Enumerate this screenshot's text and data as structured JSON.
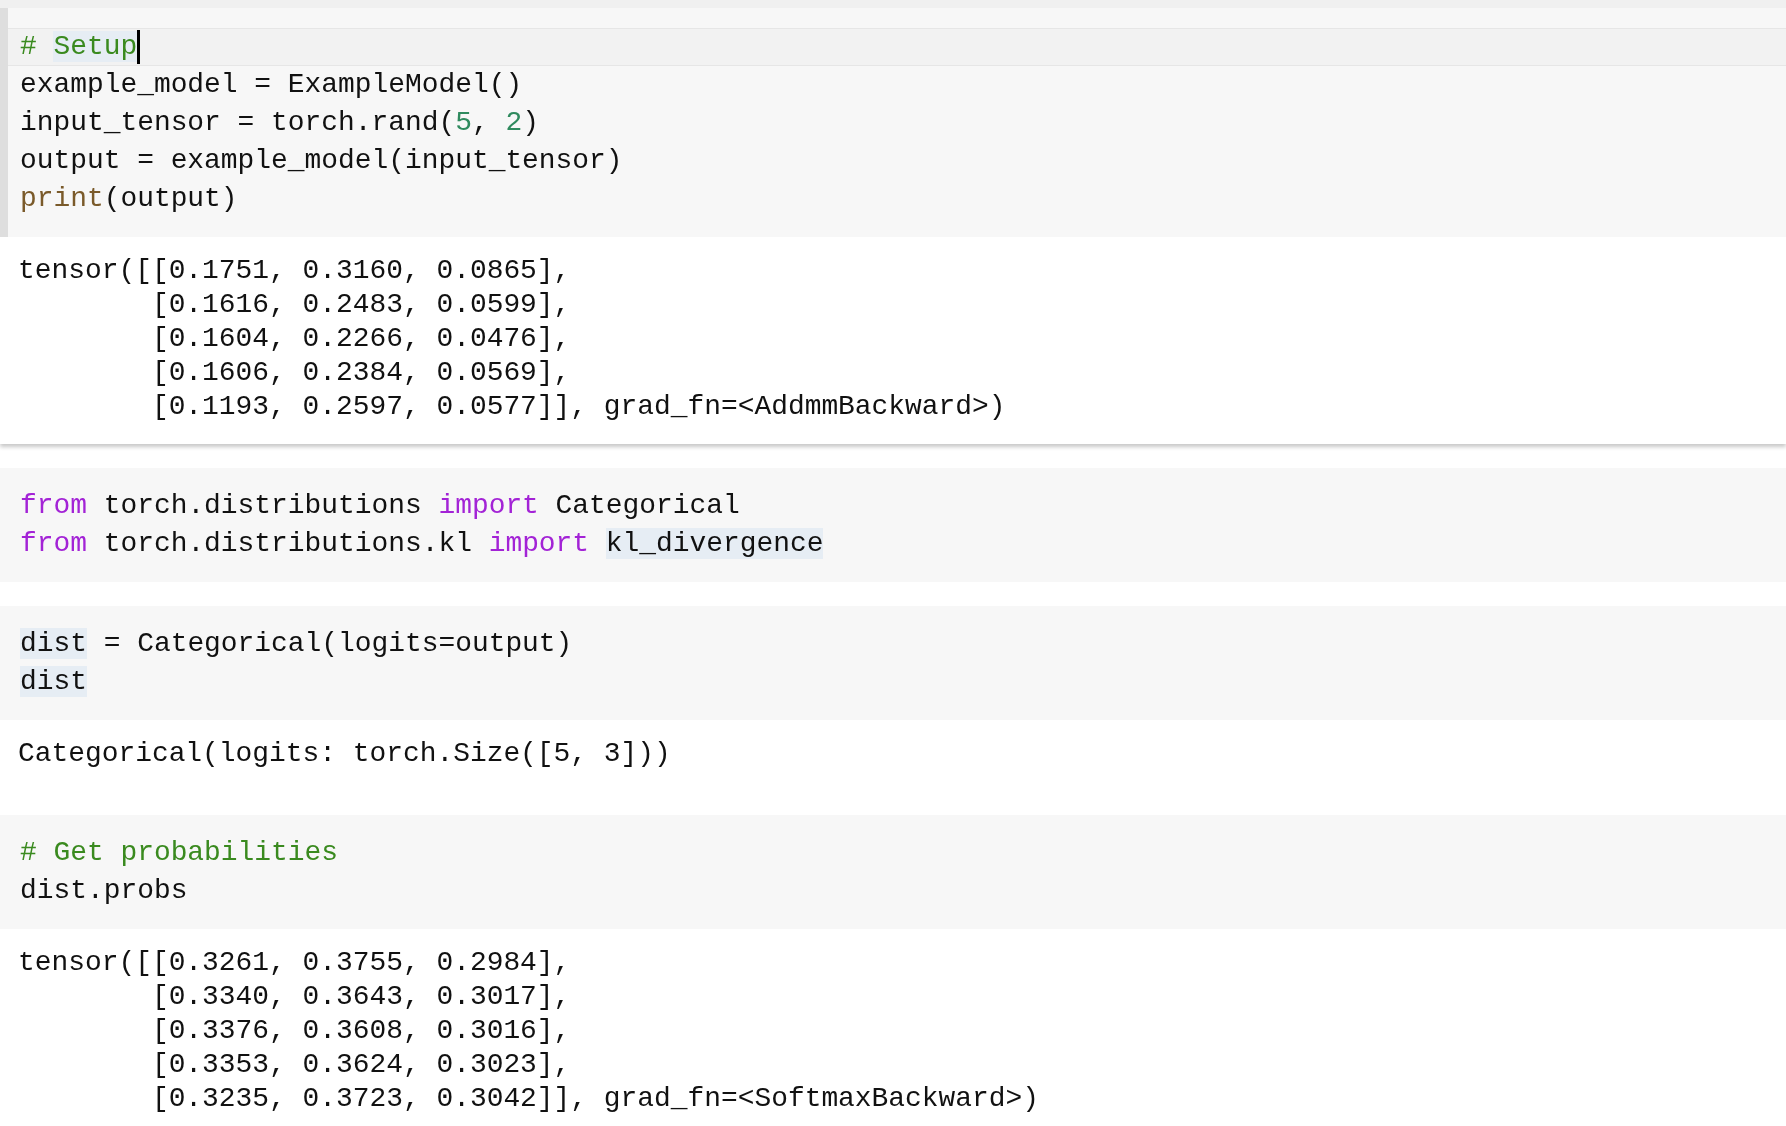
{
  "cells": [
    {
      "selected": true,
      "source": [
        {
          "active": true,
          "tokens": [
            {
              "text": "# ",
              "kind": "comment"
            },
            {
              "text": "Setup",
              "kind": "comment",
              "highlight": true
            }
          ]
        },
        {
          "tokens": [
            {
              "text": "example_model = ExampleModel()",
              "kind": "plain"
            }
          ]
        },
        {
          "tokens": [
            {
              "text": "input_tensor = torch.rand(",
              "kind": "plain"
            },
            {
              "text": "5",
              "kind": "number"
            },
            {
              "text": ", ",
              "kind": "plain"
            },
            {
              "text": "2",
              "kind": "number"
            },
            {
              "text": ")",
              "kind": "plain"
            }
          ]
        },
        {
          "tokens": [
            {
              "text": "output = example_model(input_tensor)",
              "kind": "plain"
            }
          ]
        },
        {
          "tokens": [
            {
              "text": "print",
              "kind": "builtin"
            },
            {
              "text": "(output)",
              "kind": "plain"
            }
          ]
        }
      ],
      "outputs": [
        "tensor([[0.1751, 0.3160, 0.0865],",
        "        [0.1616, 0.2483, 0.0599],",
        "        [0.1604, 0.2266, 0.0476],",
        "        [0.1606, 0.2384, 0.0569],",
        "        [0.1193, 0.2597, 0.0577]], grad_fn=<AddmmBackward>)"
      ]
    },
    {
      "selected": false,
      "source": [
        {
          "tokens": [
            {
              "text": "from",
              "kind": "keyword"
            },
            {
              "text": " torch.distributions ",
              "kind": "plain"
            },
            {
              "text": "import",
              "kind": "keyword"
            },
            {
              "text": " Categorical",
              "kind": "plain"
            }
          ]
        },
        {
          "tokens": [
            {
              "text": "from",
              "kind": "keyword"
            },
            {
              "text": " torch.distributions.kl ",
              "kind": "plain"
            },
            {
              "text": "import ",
              "kind": "keyword"
            },
            {
              "text": "kl_divergence",
              "kind": "plain",
              "highlight": true
            }
          ]
        }
      ]
    },
    {
      "selected": false,
      "source": [
        {
          "tokens": [
            {
              "text": "dist",
              "kind": "plain",
              "highlight": true
            },
            {
              "text": " = Categorical(logits=output)",
              "kind": "plain"
            }
          ]
        },
        {
          "tokens": [
            {
              "text": "dist",
              "kind": "plain",
              "highlight": true
            }
          ]
        }
      ],
      "outputs": [
        "Categorical(logits: torch.Size([5, 3]))"
      ]
    },
    {
      "selected": false,
      "source": [
        {
          "tokens": [
            {
              "text": "# Get probabilities",
              "kind": "comment"
            }
          ]
        },
        {
          "tokens": [
            {
              "text": "dist.probs",
              "kind": "plain"
            }
          ]
        }
      ],
      "outputs": [
        "tensor([[0.3261, 0.3755, 0.2984],",
        "        [0.3340, 0.3643, 0.3017],",
        "        [0.3376, 0.3608, 0.3016],",
        "        [0.3353, 0.3624, 0.3023],",
        "        [0.3235, 0.3723, 0.3042]], grad_fn=<SoftmaxBackward>)"
      ]
    }
  ]
}
